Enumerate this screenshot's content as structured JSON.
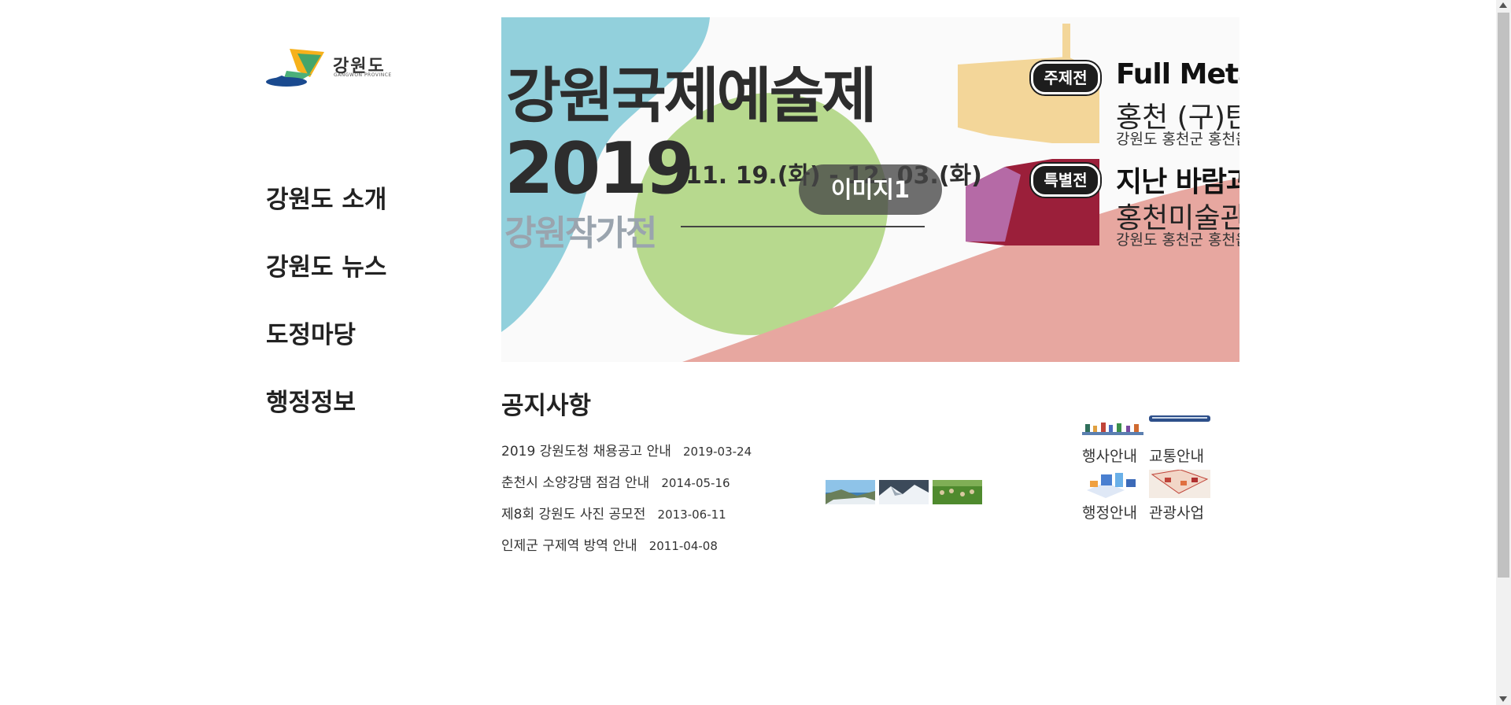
{
  "logo": {
    "text": "강원도",
    "subtext": "GANGWON PROVINCE"
  },
  "nav": {
    "items": [
      "강원도 소개",
      "강원도 뉴스",
      "도정마당",
      "행정정보"
    ]
  },
  "banner": {
    "title": "강원국제예술제",
    "year": "2019",
    "dates": "11. 19.(화) - 12. 03.(화)",
    "subtitle": "강원작가전",
    "badge1": "주제전",
    "badge2": "특별전",
    "right_heading1": "Full Metal J",
    "right_text1": "홍천 (구)탄약",
    "right_sub1": "강원도 홍천군 홍천읍",
    "right_heading2": "지난 바람과",
    "right_text2": "홍천미술관",
    "right_sub2": "강원도 홍천군 홍천읍",
    "slide_label": "이미지1",
    "colors": {
      "blue": "#92d0dc",
      "green": "#b7d98e",
      "pink": "#e7a7a0",
      "yellow": "#f3d699",
      "maroon": "#9b1f3a",
      "purple": "#b56aa6"
    }
  },
  "notices": {
    "heading": "공지사항",
    "items": [
      {
        "title": "2019 강원도청 채용공고 안내",
        "date": "2019-03-24"
      },
      {
        "title": "춘천시 소양강댐 점검 안내",
        "date": "2014-05-16"
      },
      {
        "title": "제8회 강원도 사진 공모전",
        "date": "2013-06-11"
      },
      {
        "title": "인제군 구제역 방역 안내",
        "date": "2011-04-08"
      }
    ]
  },
  "gallery": {
    "items": [
      "coast-photo",
      "snow-mountain-photo",
      "grass-field-photo"
    ]
  },
  "quick_links": {
    "items": [
      {
        "label": "행사안내",
        "icon": "event-people-icon"
      },
      {
        "label": "교통안내",
        "icon": "train-icon"
      },
      {
        "label": "행정안내",
        "icon": "admin-isometric-icon"
      },
      {
        "label": "관광사업",
        "icon": "tourism-map-icon"
      }
    ]
  }
}
